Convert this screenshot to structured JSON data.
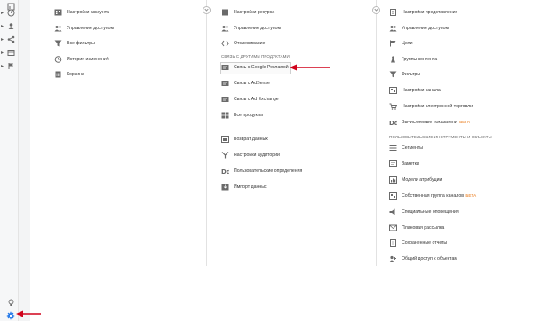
{
  "colors": {
    "arrow": "#d0021b",
    "icon": "#6a6a6a",
    "accent_gear": "#1a73e8",
    "beta": "#e8710a"
  },
  "sidebar": {
    "items": [
      {
        "name": "dashboard-icon"
      },
      {
        "name": "clock-icon"
      },
      {
        "name": "user-icon"
      },
      {
        "name": "share-icon"
      },
      {
        "name": "table-icon"
      },
      {
        "name": "flag-icon"
      }
    ],
    "bottom": [
      {
        "name": "lightbulb-icon"
      },
      {
        "name": "gear-icon"
      }
    ]
  },
  "account": {
    "items": [
      {
        "label": "Настройки аккаунта",
        "icon": "building-icon"
      },
      {
        "label": "Управление доступом",
        "icon": "users-icon"
      },
      {
        "label": "Все фильтры",
        "icon": "filter-icon"
      },
      {
        "label": "История изменений",
        "icon": "history-icon"
      },
      {
        "label": "Корзина",
        "icon": "trash-icon"
      }
    ]
  },
  "property": {
    "items": [
      {
        "label": "Настройки ресурса",
        "icon": "square-icon"
      },
      {
        "label": "Управление доступом",
        "icon": "users-icon"
      },
      {
        "label": "Отслеживание",
        "icon": "code-icon"
      }
    ],
    "section_label": "СВЯЗЬ С ДРУГИМИ ПРОДУКТАМИ",
    "links": [
      {
        "label": "Связь с Google Рекламой",
        "icon": "link-icon"
      },
      {
        "label": "Связь с AdSense",
        "icon": "link-icon"
      },
      {
        "label": "Связь с Ad Exchange",
        "icon": "link-icon"
      },
      {
        "label": "Все продукты",
        "icon": "grid-icon"
      }
    ],
    "data_items": [
      {
        "label": "Возврат данных",
        "icon": "data-icon"
      },
      {
        "label": "Настройки аудитории",
        "icon": "fork-icon"
      },
      {
        "label": "Пользовательские определения",
        "icon": "dd-icon"
      },
      {
        "label": "Импорт данных",
        "icon": "import-icon"
      }
    ]
  },
  "view": {
    "items": [
      {
        "label": "Настройки представления",
        "icon": "doc-icon"
      },
      {
        "label": "Управление доступом",
        "icon": "users-icon"
      },
      {
        "label": "Цели",
        "icon": "flag-icon"
      },
      {
        "label": "Группы контента",
        "icon": "person-icon"
      },
      {
        "label": "Фильтры",
        "icon": "filter-icon"
      },
      {
        "label": "Настройки канала",
        "icon": "channel-icon"
      },
      {
        "label": "Настройки электронной торговли",
        "icon": "cart-icon"
      },
      {
        "label": "Вычисляемые показатели",
        "beta": "БЕТА",
        "icon": "dd-icon"
      }
    ],
    "section_label": "ПОЛЬЗОВАТЕЛЬСКИЕ ИНСТРУМЕНТЫ И ОБЪЕКТЫ",
    "tools": [
      {
        "label": "Сегменты",
        "icon": "segment-icon"
      },
      {
        "label": "Заметки",
        "icon": "note-icon"
      },
      {
        "label": "Модели атрибуции",
        "icon": "model-icon"
      },
      {
        "label": "Собственная группа каналов",
        "beta": "БЕТА",
        "icon": "channel-icon"
      },
      {
        "label": "Специальные оповещения",
        "icon": "alert-icon"
      },
      {
        "label": "Плановая рассылка",
        "icon": "mail-icon"
      },
      {
        "label": "Сохраненные отчеты",
        "icon": "saved-icon"
      },
      {
        "label": "Общий доступ к объектам",
        "icon": "share-user-icon"
      }
    ]
  }
}
